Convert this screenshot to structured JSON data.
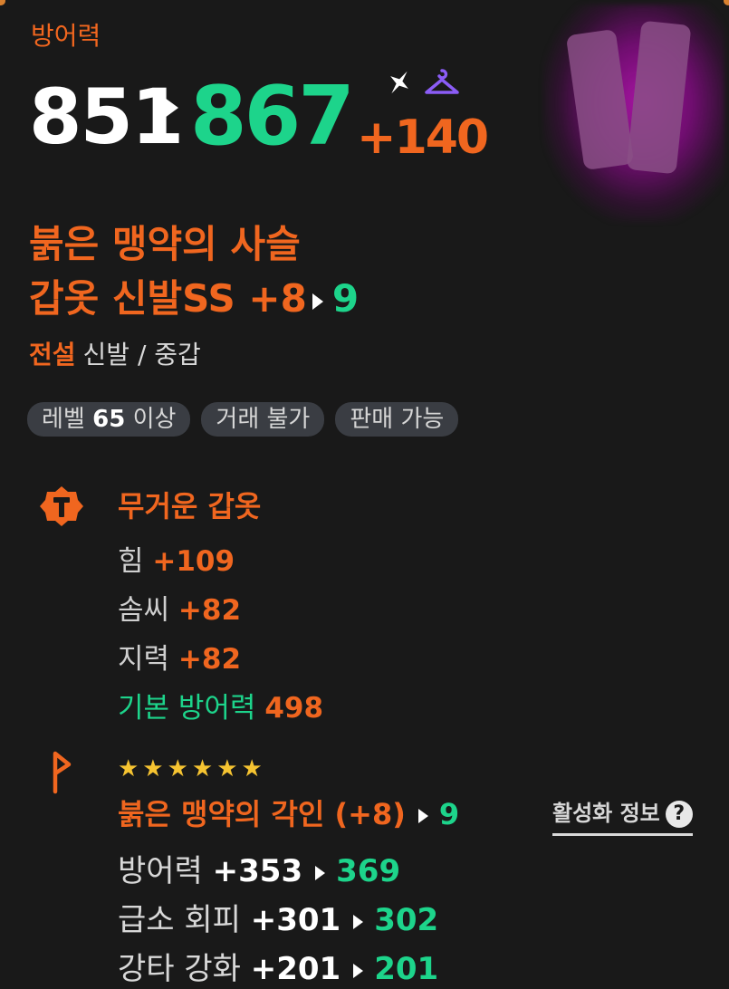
{
  "colors": {
    "accent_orange": "#f0661f",
    "up_green": "#1dd48b",
    "background": "#191919",
    "star": "#f6c431",
    "hanger": "#8b5cf6"
  },
  "header": {
    "stat_label": "방어력",
    "old_value": "851",
    "new_value": "867",
    "bonus": "+140"
  },
  "item": {
    "name_line1": "붉은 맹약의 사슬",
    "name_line2": "갑옷 신발SS +8",
    "next_level": "9",
    "rarity": "전설",
    "category": "신발 / 중갑"
  },
  "tags": {
    "level_prefix": "레벨",
    "level_value": "65",
    "level_suffix": "이상",
    "trade": "거래 불가",
    "sell": "판매 가능"
  },
  "armor_section": {
    "title": "무거운 갑옷",
    "options": [
      {
        "label": "힘",
        "value": "+109"
      },
      {
        "label": "솜씨",
        "value": "+82"
      },
      {
        "label": "지력",
        "value": "+82"
      }
    ],
    "base": {
      "label": "기본 방어력",
      "value": "498"
    }
  },
  "engraving": {
    "stars": "★★★★★★",
    "title": "붉은 맹약의 각인 (+8)",
    "next": "9",
    "activation_link": "활성화 정보",
    "options": [
      {
        "label": "방어력",
        "value": "+353",
        "next": "369"
      },
      {
        "label": "급소 회피",
        "value": "+301",
        "next": "302"
      },
      {
        "label": "강타 강화",
        "value": "+201",
        "next": "201"
      }
    ]
  },
  "icons": [
    "sparkle-icon",
    "hanger-icon",
    "armor-badge-icon",
    "rune-icon",
    "help-icon"
  ]
}
